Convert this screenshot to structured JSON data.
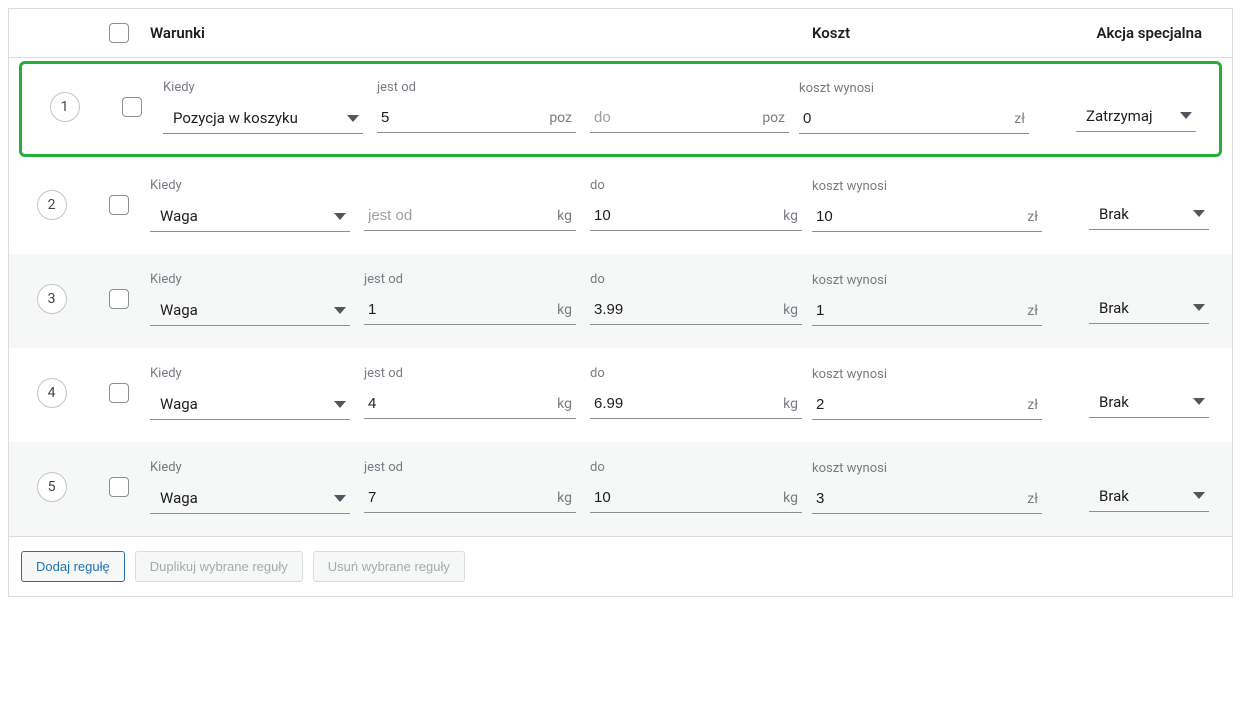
{
  "headers": {
    "conditions": "Warunki",
    "cost": "Koszt",
    "action": "Akcja specjalna"
  },
  "labels": {
    "when": "Kiedy",
    "from": "jest od",
    "to": "do",
    "cost_is": "koszt wynosi"
  },
  "units": {
    "poz": "poz",
    "kg": "kg",
    "zl": "zł"
  },
  "rules": [
    {
      "num": "1",
      "highlighted": true,
      "when": "Pozycja w koszyku",
      "from_val": "5",
      "from_placeholder": "",
      "to_val": "",
      "to_placeholder": "do",
      "unit": "poz",
      "cost": "0",
      "action": "Zatrzymaj"
    },
    {
      "num": "2",
      "highlighted": false,
      "when": "Waga",
      "from_val": "",
      "from_placeholder": "jest od",
      "to_val": "10",
      "to_placeholder": "",
      "unit": "kg",
      "cost": "10",
      "action": "Brak"
    },
    {
      "num": "3",
      "highlighted": false,
      "when": "Waga",
      "from_val": "1",
      "from_placeholder": "",
      "to_val": "3.99",
      "to_placeholder": "",
      "unit": "kg",
      "cost": "1",
      "action": "Brak"
    },
    {
      "num": "4",
      "highlighted": false,
      "when": "Waga",
      "from_val": "4",
      "from_placeholder": "",
      "to_val": "6.99",
      "to_placeholder": "",
      "unit": "kg",
      "cost": "2",
      "action": "Brak"
    },
    {
      "num": "5",
      "highlighted": false,
      "when": "Waga",
      "from_val": "7",
      "from_placeholder": "",
      "to_val": "10",
      "to_placeholder": "",
      "unit": "kg",
      "cost": "3",
      "action": "Brak"
    }
  ],
  "footer": {
    "add": "Dodaj regułę",
    "duplicate": "Duplikuj wybrane reguły",
    "delete": "Usuń wybrane reguły"
  }
}
